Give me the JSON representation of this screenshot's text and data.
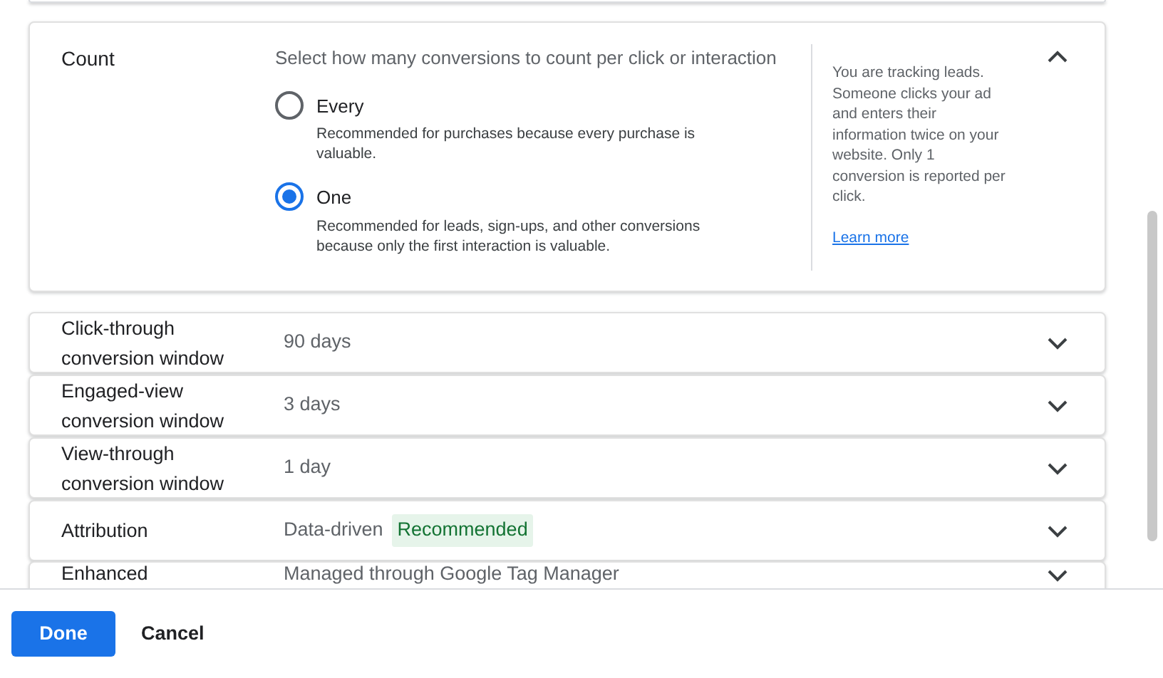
{
  "count_section": {
    "label": "Count",
    "expanded": true,
    "prompt": "Select how many conversions to count per click or interaction",
    "options": [
      {
        "label": "Every",
        "description": "Recommended for purchases because every purchase is valuable.",
        "selected": false
      },
      {
        "label": "One",
        "description": "Recommended for leads, sign-ups, and other conversions because only the first interaction is valuable.",
        "selected": true
      }
    ],
    "help_text": "You are tracking leads. Someone clicks your ad and enters their information twice on your website. Only 1 conversion is reported per click.",
    "learn_more_link": "Learn more"
  },
  "settings_rows": [
    {
      "label": "Click-through conversion window",
      "value": "90 days",
      "expanded": false
    },
    {
      "label": "Engaged-view conversion window",
      "value": "3 days",
      "expanded": false
    },
    {
      "label": "View-through conversion window",
      "value": "1 day",
      "expanded": false
    },
    {
      "label": "Attribution",
      "value": "Data-driven",
      "badge": "Recommended",
      "expanded": false
    },
    {
      "label": "Enhanced",
      "value": "Managed through Google Tag Manager",
      "expanded": false
    }
  ],
  "footer": {
    "primary_button": "Done",
    "secondary_button": "Cancel"
  }
}
